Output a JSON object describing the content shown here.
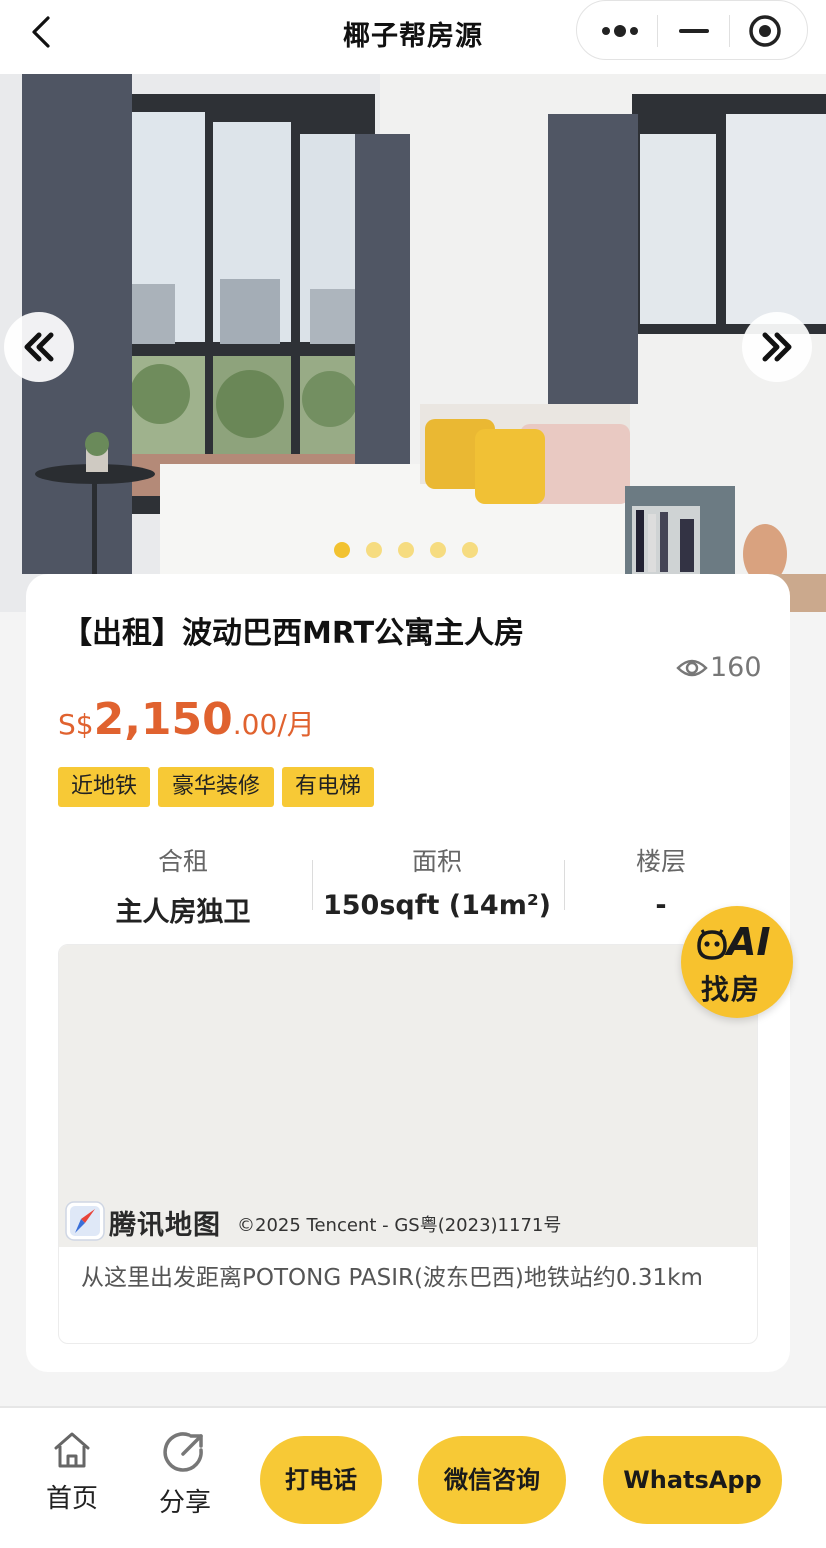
{
  "header": {
    "title": "椰子帮房源",
    "icons": [
      "back-icon",
      "more-icon",
      "minimize-icon",
      "close-app-icon"
    ]
  },
  "gallery": {
    "slide_count": 5,
    "active_index": 0,
    "prev_icon": "double-chevron-left-icon",
    "next_icon": "double-chevron-right-icon"
  },
  "listing": {
    "title": "【出租】波动巴西MRT公寓主人房",
    "views": "160",
    "price": {
      "currency": "S$",
      "integer": "2,150",
      "decimal": ".00",
      "unit": "/月"
    },
    "tags": [
      "近地铁",
      "豪华装修",
      "有电梯"
    ],
    "specs": [
      {
        "label": "合租",
        "value": "主人房独卫"
      },
      {
        "label": "面积",
        "value": "150sqft (14m²)"
      },
      {
        "label": "楼层",
        "value": "-"
      }
    ]
  },
  "map": {
    "brand": "腾讯地图",
    "copyright": "©2025 Tencent - GS粤(2023)1171号",
    "distance_text": "从这里出发距离POTONG PASIR(波东巴西)地铁站约0.31km"
  },
  "ai_badge": {
    "label": "AI",
    "sub": "找房"
  },
  "bottom_bar": {
    "home_label": "首页",
    "share_label": "分享",
    "call_label": "打电话",
    "wechat_label": "微信咨询",
    "whatsapp_label": "WhatsApp"
  },
  "colors": {
    "accent": "#f7c936",
    "price": "#e0622f",
    "map_bg": "#efeeeb"
  }
}
